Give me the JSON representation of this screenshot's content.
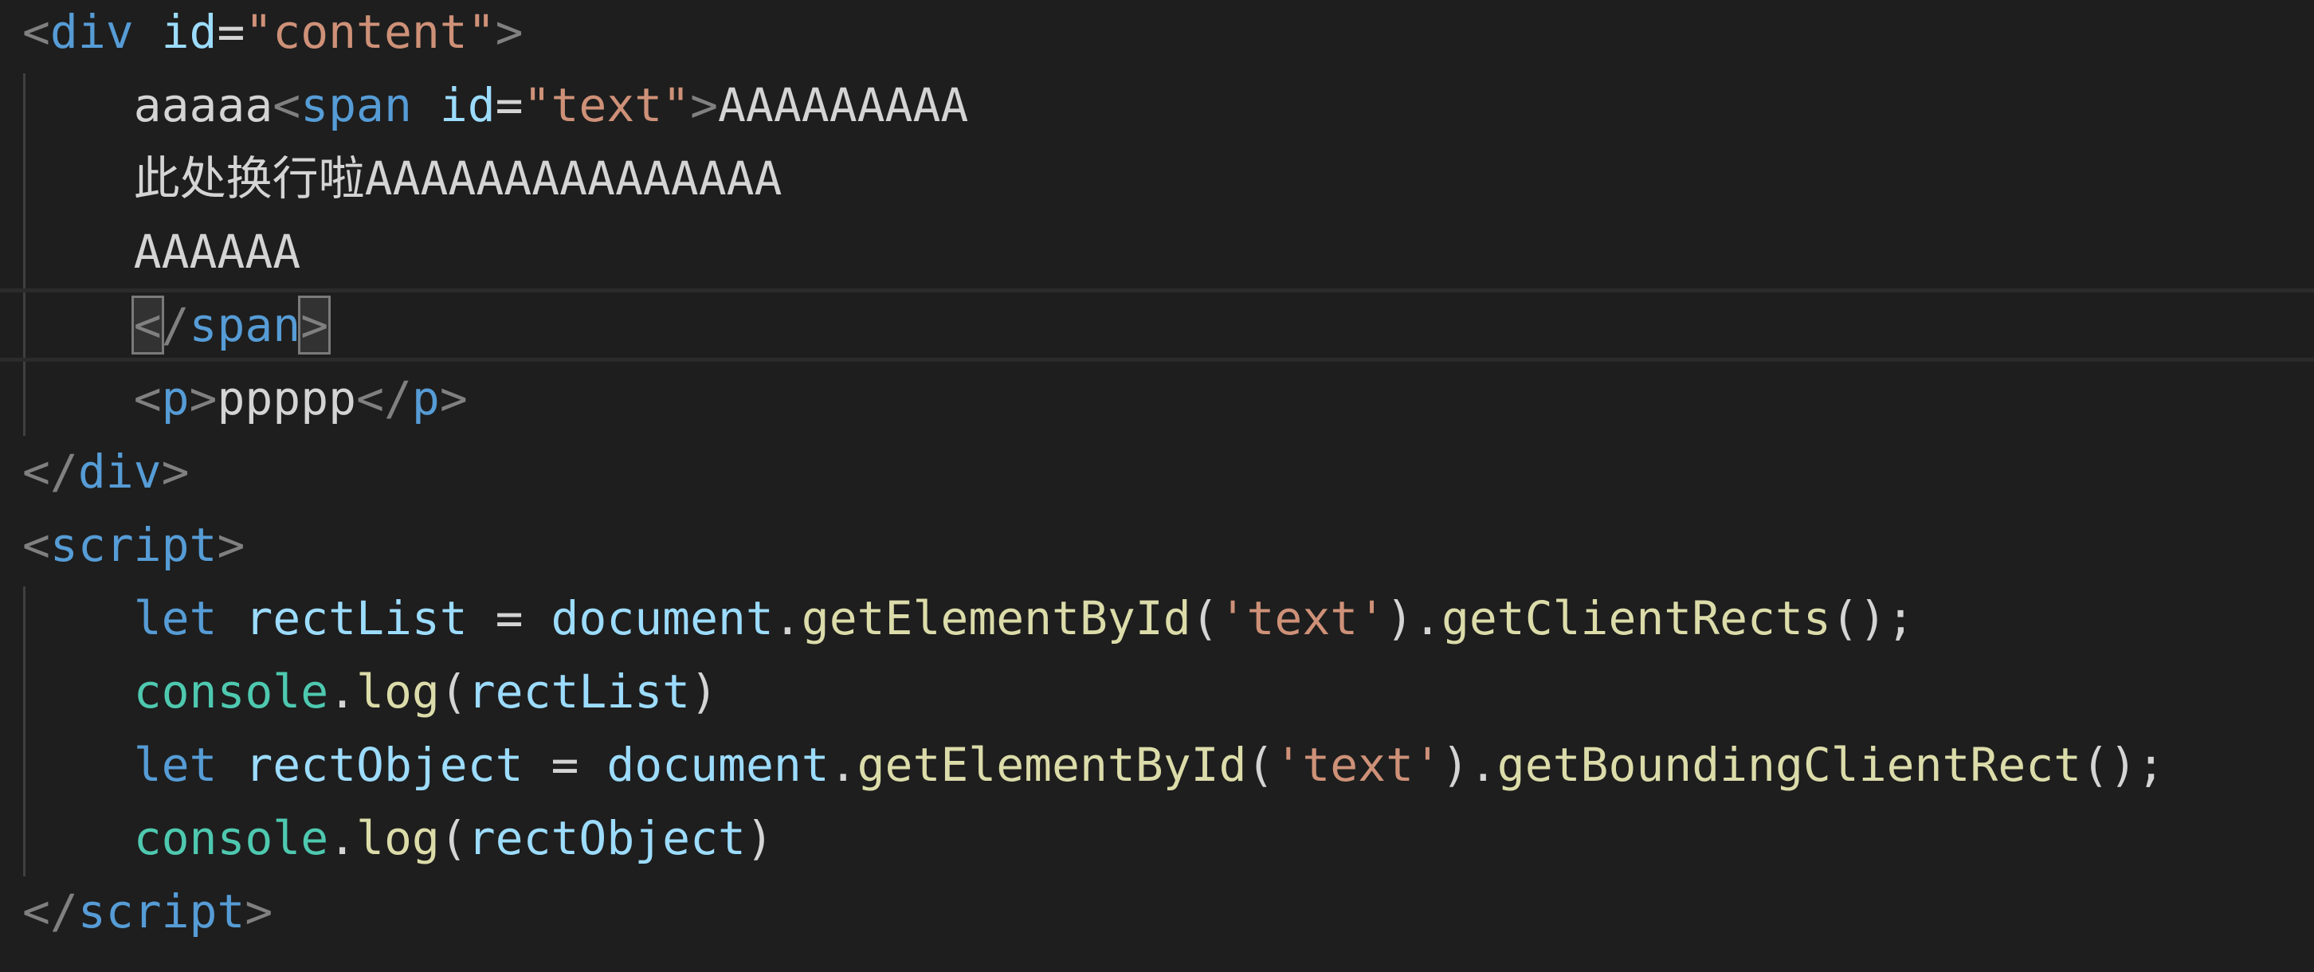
{
  "code_lines": [
    [
      {
        "t": "<",
        "c": "tk-bracket"
      },
      {
        "t": "div",
        "c": "tk-tag"
      },
      {
        "t": " ",
        "c": "tk-text"
      },
      {
        "t": "id",
        "c": "tk-attr"
      },
      {
        "t": "=",
        "c": "tk-eq"
      },
      {
        "t": "\"content\"",
        "c": "tk-str"
      },
      {
        "t": ">",
        "c": "tk-bracket"
      }
    ],
    [
      {
        "t": "    aaaaa",
        "c": "tk-text"
      },
      {
        "t": "<",
        "c": "tk-bracket"
      },
      {
        "t": "span",
        "c": "tk-tag"
      },
      {
        "t": " ",
        "c": "tk-text"
      },
      {
        "t": "id",
        "c": "tk-attr"
      },
      {
        "t": "=",
        "c": "tk-eq"
      },
      {
        "t": "\"text\"",
        "c": "tk-str"
      },
      {
        "t": ">",
        "c": "tk-bracket"
      },
      {
        "t": "AAAAAAAAA",
        "c": "tk-text"
      }
    ],
    [
      {
        "t": "    此处换行啦AAAAAAAAAAAAAAA",
        "c": "tk-text"
      }
    ],
    [
      {
        "t": "    AAAAAA",
        "c": "tk-text"
      }
    ],
    [
      {
        "t": "    ",
        "c": "tk-text"
      },
      {
        "t": "<",
        "c": "tk-bracket match"
      },
      {
        "t": "/",
        "c": "tk-bracket"
      },
      {
        "t": "span",
        "c": "tk-tag"
      },
      {
        "t": ">",
        "c": "tk-bracket match"
      }
    ],
    [
      {
        "t": "    ",
        "c": "tk-text"
      },
      {
        "t": "<",
        "c": "tk-bracket"
      },
      {
        "t": "p",
        "c": "tk-tag"
      },
      {
        "t": ">",
        "c": "tk-bracket"
      },
      {
        "t": "ppppp",
        "c": "tk-text"
      },
      {
        "t": "</",
        "c": "tk-bracket"
      },
      {
        "t": "p",
        "c": "tk-tag"
      },
      {
        "t": ">",
        "c": "tk-bracket"
      }
    ],
    [
      {
        "t": "</",
        "c": "tk-bracket"
      },
      {
        "t": "div",
        "c": "tk-tag"
      },
      {
        "t": ">",
        "c": "tk-bracket"
      }
    ],
    [
      {
        "t": "<",
        "c": "tk-bracket"
      },
      {
        "t": "script",
        "c": "tk-tag"
      },
      {
        "t": ">",
        "c": "tk-bracket"
      }
    ],
    [
      {
        "t": "    ",
        "c": "tk-text"
      },
      {
        "t": "let",
        "c": "tk-kw"
      },
      {
        "t": " ",
        "c": "tk-text"
      },
      {
        "t": "rectList",
        "c": "tk-var"
      },
      {
        "t": " = ",
        "c": "tk-punc"
      },
      {
        "t": "document",
        "c": "tk-var"
      },
      {
        "t": ".",
        "c": "tk-punc"
      },
      {
        "t": "getElementById",
        "c": "tk-fn"
      },
      {
        "t": "(",
        "c": "tk-punc"
      },
      {
        "t": "'text'",
        "c": "tk-str"
      },
      {
        "t": ").",
        "c": "tk-punc"
      },
      {
        "t": "getClientRects",
        "c": "tk-fn"
      },
      {
        "t": "();",
        "c": "tk-punc"
      }
    ],
    [
      {
        "t": "    ",
        "c": "tk-text"
      },
      {
        "t": "console",
        "c": "tk-cls"
      },
      {
        "t": ".",
        "c": "tk-punc"
      },
      {
        "t": "log",
        "c": "tk-fn"
      },
      {
        "t": "(",
        "c": "tk-punc"
      },
      {
        "t": "rectList",
        "c": "tk-var"
      },
      {
        "t": ")",
        "c": "tk-punc"
      }
    ],
    [
      {
        "t": "    ",
        "c": "tk-text"
      },
      {
        "t": "let",
        "c": "tk-kw"
      },
      {
        "t": " ",
        "c": "tk-text"
      },
      {
        "t": "rectObject",
        "c": "tk-var"
      },
      {
        "t": " = ",
        "c": "tk-punc"
      },
      {
        "t": "document",
        "c": "tk-var"
      },
      {
        "t": ".",
        "c": "tk-punc"
      },
      {
        "t": "getElementById",
        "c": "tk-fn"
      },
      {
        "t": "(",
        "c": "tk-punc"
      },
      {
        "t": "'text'",
        "c": "tk-str"
      },
      {
        "t": ").",
        "c": "tk-punc"
      },
      {
        "t": "getBoundingClientRect",
        "c": "tk-fn"
      },
      {
        "t": "();",
        "c": "tk-punc"
      }
    ],
    [
      {
        "t": "    ",
        "c": "tk-text"
      },
      {
        "t": "console",
        "c": "tk-cls"
      },
      {
        "t": ".",
        "c": "tk-punc"
      },
      {
        "t": "log",
        "c": "tk-fn"
      },
      {
        "t": "(",
        "c": "tk-punc"
      },
      {
        "t": "rectObject",
        "c": "tk-var"
      },
      {
        "t": ")",
        "c": "tk-punc"
      }
    ],
    [
      {
        "t": "</",
        "c": "tk-bracket"
      },
      {
        "t": "script",
        "c": "tk-tag"
      },
      {
        "t": ">",
        "c": "tk-bracket"
      }
    ]
  ],
  "current_line_index": 4,
  "theme": {
    "background": "#1e1e1e",
    "tag": "#569cd6",
    "attribute": "#9cdcfe",
    "string": "#ce9178",
    "function": "#dcdcaa",
    "class": "#4ec9b0",
    "bracket": "#808080",
    "text": "#d4d4d4"
  }
}
